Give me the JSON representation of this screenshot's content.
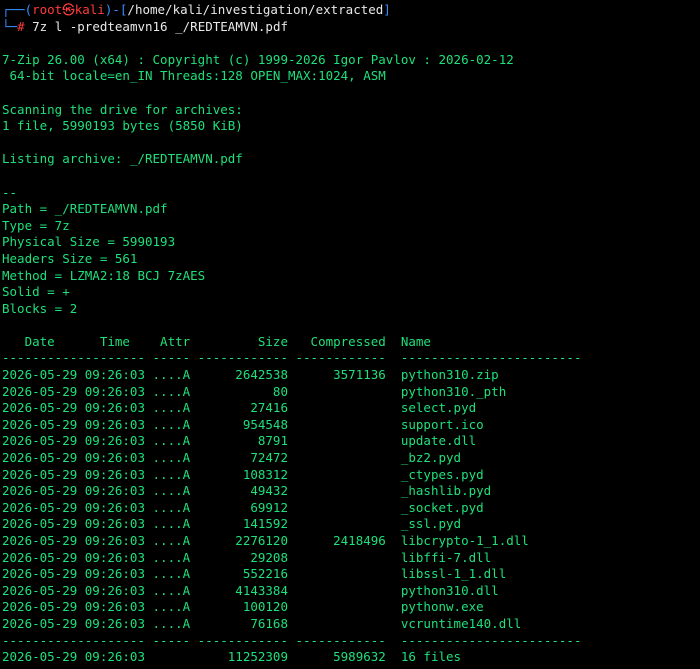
{
  "prompt": {
    "open": "┌──(",
    "user": "root",
    "at": "㉿",
    "host": "kali",
    "close": ")-[",
    "cwd": "/home/kali/investigation/extracted",
    "end": "]",
    "line2_prefix": "└─",
    "hash": "#",
    "command": "7z l -predteamvn16 _/REDTEAMVN.pdf"
  },
  "header": [
    "7-Zip 26.00 (x64) : Copyright (c) 1999-2026 Igor Pavlov : 2026-02-12",
    " 64-bit locale=en_IN Threads:128 OPEN_MAX:1024, ASM"
  ],
  "scan": [
    "Scanning the drive for archives:",
    "1 file, 5990193 bytes (5850 KiB)"
  ],
  "listing_line": "Listing archive: _/REDTEAMVN.pdf",
  "props": [
    "--",
    "Path = _/REDTEAMVN.pdf",
    "Type = 7z",
    "Physical Size = 5990193",
    "Headers Size = 561",
    "Method = LZMA2:18 BCJ 7zAES",
    "Solid = +",
    "Blocks = 2"
  ],
  "table": {
    "header_line": "   Date      Time    Attr         Size   Compressed  Name",
    "separator": "------------------- ----- ------------ ------------  ------------------------",
    "rows": [
      "2026-05-29 09:26:03 ....A      2642538      3571136  python310.zip",
      "2026-05-29 09:26:03 ....A           80               python310._pth",
      "2026-05-29 09:26:03 ....A        27416               select.pyd",
      "2026-05-29 09:26:03 ....A       954548               support.ico",
      "2026-05-29 09:26:03 ....A         8791               update.dll",
      "2026-05-29 09:26:03 ....A        72472               _bz2.pyd",
      "2026-05-29 09:26:03 ....A       108312               _ctypes.pyd",
      "2026-05-29 09:26:03 ....A        49432               _hashlib.pyd",
      "2026-05-29 09:26:03 ....A        69912               _socket.pyd",
      "2026-05-29 09:26:03 ....A       141592               _ssl.pyd",
      "2026-05-29 09:26:03 ....A      2276120      2418496  libcrypto-1_1.dll",
      "2026-05-29 09:26:03 ....A        29208               libffi-7.dll",
      "2026-05-29 09:26:03 ....A       552216               libssl-1_1.dll",
      "2026-05-29 09:26:03 ....A      4143384               python310.dll",
      "2026-05-29 09:26:03 ....A       100120               pythonw.exe",
      "2026-05-29 09:26:03 ....A        76168               vcruntime140.dll"
    ],
    "footer_separator": "------------------- ----- ------------ ------------  ------------------------",
    "summary": "2026-05-29 09:26:03           11252309      5989632  16 files"
  }
}
